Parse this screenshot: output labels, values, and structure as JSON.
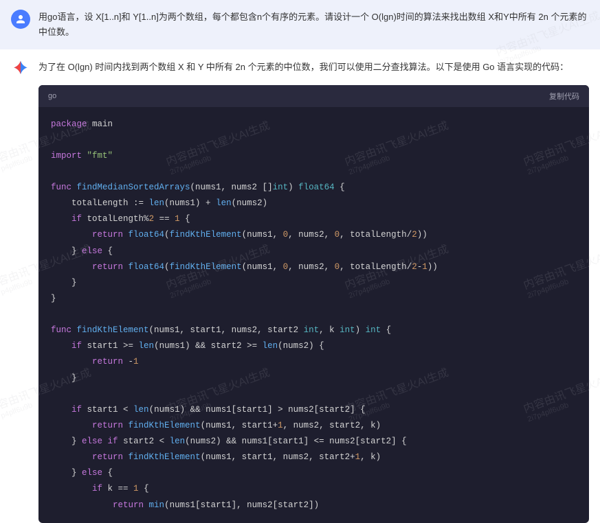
{
  "user": {
    "text": "用go语言，设 X[1..n]和 Y[1..n]为两个数组，每个都包含n个有序的元素。请设计一个 O(lgn)时间的算法来找出数组 X和Y中所有 2n 个元素的中位数。"
  },
  "assistant": {
    "intro": "为了在 O(lgn) 时间内找到两个数组 X 和 Y 中所有 2n 个元素的中位数，我们可以使用二分查找算法。以下是使用 Go 语言实现的代码：",
    "code_lang": "go",
    "copy_label": "复制代码"
  },
  "code": {
    "l1_kw1": "package",
    "l1_id": " main",
    "l3_kw1": "import",
    "l3_str": " \"fmt\"",
    "l5_kw1": "func",
    "l5_fn": " findMedianSortedArrays",
    "l5_sig1": "(nums1, nums2 []",
    "l5_type": "int",
    "l5_sig2": ") ",
    "l5_ret": "float64",
    "l5_sig3": " {",
    "l6": "    totalLength := ",
    "l6_fn": "len",
    "l6_b": "(nums1) + ",
    "l6_fn2": "len",
    "l6_c": "(nums2)",
    "l7_a": "    ",
    "l7_kw": "if",
    "l7_b": " totalLength%",
    "l7_num": "2",
    "l7_c": " == ",
    "l7_num2": "1",
    "l7_d": " {",
    "l8_a": "        ",
    "l8_kw": "return",
    "l8_b": " ",
    "l8_fn": "float64",
    "l8_c": "(",
    "l8_fn2": "findKthElement",
    "l8_d": "(nums1, ",
    "l8_n1": "0",
    "l8_e": ", nums2, ",
    "l8_n2": "0",
    "l8_f": ", totalLength/",
    "l8_n3": "2",
    "l8_g": "))",
    "l9_a": "    } ",
    "l9_kw": "else",
    "l9_b": " {",
    "l10_a": "        ",
    "l10_kw": "return",
    "l10_b": " ",
    "l10_fn": "float64",
    "l10_c": "(",
    "l10_fn2": "findKthElement",
    "l10_d": "(nums1, ",
    "l10_n1": "0",
    "l10_e": ", nums2, ",
    "l10_n2": "0",
    "l10_f": ", totalLength/",
    "l10_n3": "2",
    "l10_g": "-",
    "l10_n4": "1",
    "l10_h": "))",
    "l11": "    }",
    "l12": "}",
    "l14_kw1": "func",
    "l14_fn": " findKthElement",
    "l14_sig1": "(nums1, start1, nums2, start2 ",
    "l14_type": "int",
    "l14_sig2": ", k ",
    "l14_type2": "int",
    "l14_sig3": ") ",
    "l14_ret": "int",
    "l14_sig4": " {",
    "l15_a": "    ",
    "l15_kw": "if",
    "l15_b": " start1 >= ",
    "l15_fn": "len",
    "l15_c": "(nums1) && start2 >= ",
    "l15_fn2": "len",
    "l15_d": "(nums2) {",
    "l16_a": "        ",
    "l16_kw": "return",
    "l16_b": " -",
    "l16_num": "1",
    "l17": "    }",
    "l19_a": "    ",
    "l19_kw": "if",
    "l19_b": " start1 < ",
    "l19_fn": "len",
    "l19_c": "(nums1) && nums1[start1] > nums2[start2] {",
    "l20_a": "        ",
    "l20_kw": "return",
    "l20_b": " ",
    "l20_fn": "findKthElement",
    "l20_c": "(nums1, start1+",
    "l20_num": "1",
    "l20_d": ", nums2, start2, k)",
    "l21_a": "    } ",
    "l21_kw": "else",
    "l21_b": " ",
    "l21_kw2": "if",
    "l21_c": " start2 < ",
    "l21_fn": "len",
    "l21_d": "(nums2) && nums1[start1] <= nums2[start2] {",
    "l22_a": "        ",
    "l22_kw": "return",
    "l22_b": " ",
    "l22_fn": "findKthElement",
    "l22_c": "(nums1, start1, nums2, start2+",
    "l22_num": "1",
    "l22_d": ", k)",
    "l23_a": "    } ",
    "l23_kw": "else",
    "l23_b": " {",
    "l24_a": "        ",
    "l24_kw": "if",
    "l24_b": " k == ",
    "l24_num": "1",
    "l24_c": " {",
    "l25_a": "            ",
    "l25_kw": "return",
    "l25_b": " ",
    "l25_fn": "min",
    "l25_c": "(nums1[start1], nums2[start2])"
  },
  "watermark": {
    "main": "内容由讯飞星火AI生成",
    "sub": "2i7p4plf6u9b"
  }
}
